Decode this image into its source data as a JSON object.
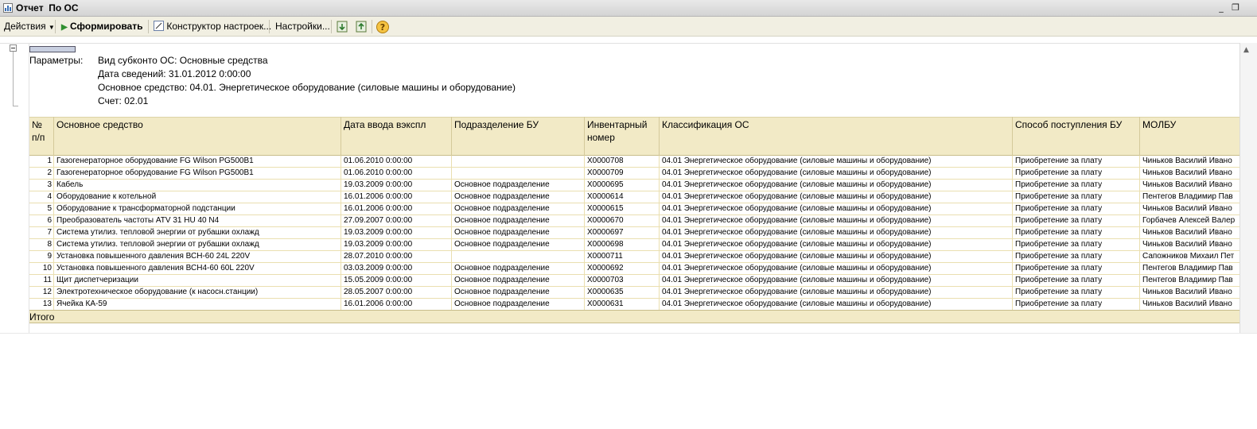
{
  "window": {
    "title": "Отчет  По ОС"
  },
  "toolbar": {
    "actions_label": "Действия",
    "generate_label": "Сформировать",
    "constructor_label": "Конструктор настроек...",
    "settings_label": "Настройки...",
    "help_label": "?"
  },
  "params": {
    "label": "Параметры:",
    "lines": [
      "Вид субконто ОС: Основные средства",
      "Дата сведений: 31.01.2012 0:00:00",
      "Основное средство: 04.01. Энергетическое оборудование (силовые машины и оборудование)",
      "Счет: 02.01"
    ]
  },
  "table": {
    "columns": [
      "№\nп/п",
      "Основное средство",
      "Дата ввода вэкспл",
      "Подразделение БУ",
      "Инвентарный\nномер",
      "Классификация ОС",
      "Способ поступления БУ",
      "МОЛБУ"
    ],
    "rows": [
      [
        "1",
        "Газогенераторное оборудование FG Wilson PG500B1",
        "01.06.2010 0:00:00",
        "",
        "X0000708",
        "04.01 Энергетическое оборудование (силовые машины и оборудование)",
        "Приобретение за плату",
        "Чиньков Василий Ивано"
      ],
      [
        "2",
        "Газогенераторное оборудование FG Wilson PG500B1",
        "01.06.2010 0:00:00",
        "",
        "X0000709",
        "04.01 Энергетическое оборудование (силовые машины и оборудование)",
        "Приобретение за плату",
        "Чиньков Василий Ивано"
      ],
      [
        "3",
        "Кабель",
        "19.03.2009 0:00:00",
        "Основное подразделение",
        "X0000695",
        "04.01 Энергетическое оборудование (силовые машины и оборудование)",
        "Приобретение за плату",
        "Чиньков Василий Ивано"
      ],
      [
        "4",
        "Оборудование к котельной",
        "16.01.2006 0:00:00",
        "Основное подразделение",
        "X0000614",
        "04.01 Энергетическое оборудование (силовые машины и оборудование)",
        "Приобретение за плату",
        "Пентегов Владимир Пав"
      ],
      [
        "5",
        "Оборудование к трансформаторной подстанции",
        "16.01.2006 0:00:00",
        "Основное подразделение",
        "X0000615",
        "04.01 Энергетическое оборудование (силовые машины и оборудование)",
        "Приобретение за плату",
        "Чиньков Василий Ивано"
      ],
      [
        "6",
        "Преобразователь частоты ATV 31 HU 40 N4",
        "27.09.2007 0:00:00",
        "Основное подразделение",
        "X0000670",
        "04.01 Энергетическое оборудование (силовые машины и оборудование)",
        "Приобретение за плату",
        "Горбачев Алексей Валер"
      ],
      [
        "7",
        "Система утилиз. тепловой энергии от рубашки охлажд",
        "19.03.2009 0:00:00",
        "Основное подразделение",
        "X0000697",
        "04.01 Энергетическое оборудование (силовые машины и оборудование)",
        "Приобретение за плату",
        "Чиньков Василий Ивано"
      ],
      [
        "8",
        "Система утилиз. тепловой энергии от рубашки охлажд",
        "19.03.2009 0:00:00",
        "Основное подразделение",
        "X0000698",
        "04.01 Энергетическое оборудование (силовые машины и оборудование)",
        "Приобретение за плату",
        "Чиньков Василий Ивано"
      ],
      [
        "9",
        "Установка повышенного давления ВСН-60  24L 220V",
        "28.07.2010 0:00:00",
        "",
        "X0000711",
        "04.01 Энергетическое оборудование (силовые машины и оборудование)",
        "Приобретение за плату",
        "Сапожников Михаил Пет"
      ],
      [
        "10",
        "Установка повышенного давления ВСН4-60 60L 220V",
        "03.03.2009 0:00:00",
        "Основное подразделение",
        "X0000692",
        "04.01 Энергетическое оборудование (силовые машины и оборудование)",
        "Приобретение за плату",
        "Пентегов Владимир Пав"
      ],
      [
        "11",
        "Щит диспетчеризации",
        "15.05.2009 0:00:00",
        "Основное подразделение",
        "X0000703",
        "04.01 Энергетическое оборудование (силовые машины и оборудование)",
        "Приобретение за плату",
        "Пентегов Владимир Пав"
      ],
      [
        "12",
        "Электротехническое оборудование (к насосн.станции)",
        "28.05.2007 0:00:00",
        "Основное подразделение",
        "X0000635",
        "04.01 Энергетическое оборудование (силовые машины и оборудование)",
        "Приобретение за плату",
        "Чиньков Василий Ивано"
      ],
      [
        "13",
        "Ячейка КА-59",
        "16.01.2006 0:00:00",
        "Основное подразделение",
        "X0000631",
        "04.01 Энергетическое оборудование (силовые машины и оборудование)",
        "Приобретение за плату",
        "Чиньков Василий Ивано"
      ]
    ],
    "total_label": "Итого"
  }
}
